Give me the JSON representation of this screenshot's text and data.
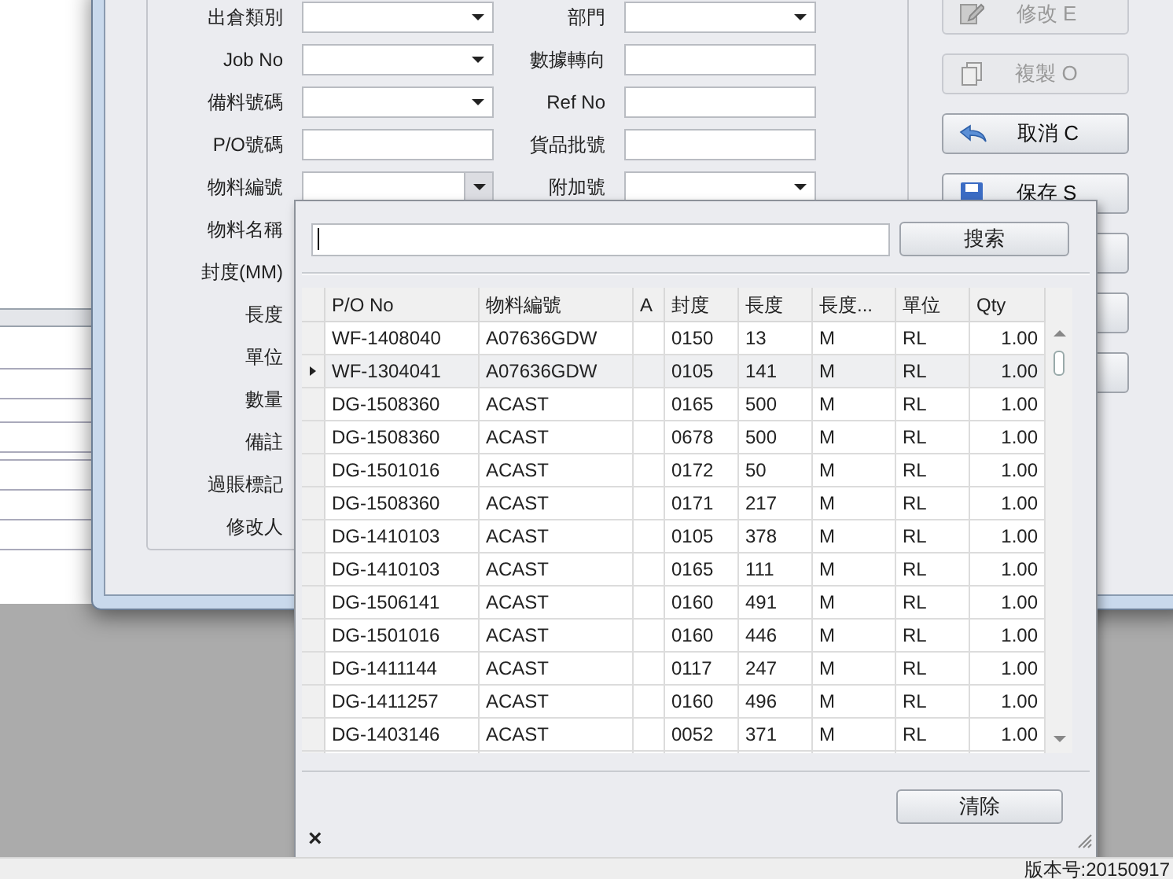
{
  "form": {
    "left_fields": [
      {
        "label": "出倉類別",
        "kind": "dropdown",
        "expanded": false
      },
      {
        "label": "Job No",
        "kind": "dropdown",
        "expanded": false
      },
      {
        "label": "備料號碼",
        "kind": "dropdown",
        "expanded": false
      },
      {
        "label": "P/O號碼",
        "kind": "text"
      },
      {
        "label": "物料編號",
        "kind": "dropdown",
        "expanded": true
      },
      {
        "label": "物料名稱",
        "kind": "hidden"
      },
      {
        "label": "封度(MM)",
        "kind": "hidden"
      },
      {
        "label": "長度",
        "kind": "hidden"
      },
      {
        "label": "單位",
        "kind": "hidden"
      },
      {
        "label": "數量",
        "kind": "hidden"
      },
      {
        "label": "備註",
        "kind": "hidden"
      },
      {
        "label": "過賬標記",
        "kind": "hidden"
      },
      {
        "label": "修改人",
        "kind": "hidden"
      }
    ],
    "right_fields": [
      {
        "label": "部門",
        "kind": "dropdown",
        "expanded": false
      },
      {
        "label": "數據轉向",
        "kind": "text"
      },
      {
        "label": "Ref No",
        "kind": "text"
      },
      {
        "label": "貨品批號",
        "kind": "text"
      },
      {
        "label": "附加號",
        "kind": "dropdown",
        "expanded": false
      }
    ]
  },
  "actions": [
    {
      "label": "修改 E",
      "kind": "edit",
      "disabled": true
    },
    {
      "label": "複製 O",
      "kind": "copy",
      "disabled": true
    },
    {
      "label": "取消 C",
      "kind": "undo",
      "disabled": false
    },
    {
      "label": "保存 S",
      "kind": "save",
      "disabled": false
    }
  ],
  "popup": {
    "search_button": "搜索",
    "columns": [
      "P/O No",
      "物料編號",
      "A",
      "封度",
      "長度",
      "長度...",
      "單位",
      "Qty"
    ],
    "rows": [
      {
        "selected": false,
        "cells": [
          "WF-1408040",
          "A07636GDW",
          "",
          "0150",
          "13",
          "M",
          "RL",
          "1.00"
        ]
      },
      {
        "selected": true,
        "cells": [
          "WF-1304041",
          "A07636GDW",
          "",
          "0105",
          "141",
          "M",
          "RL",
          "1.00"
        ]
      },
      {
        "selected": false,
        "cells": [
          "DG-1508360",
          "ACAST",
          "",
          "0165",
          "500",
          "M",
          "RL",
          "1.00"
        ]
      },
      {
        "selected": false,
        "cells": [
          "DG-1508360",
          "ACAST",
          "",
          "0678",
          "500",
          "M",
          "RL",
          "1.00"
        ]
      },
      {
        "selected": false,
        "cells": [
          "DG-1501016",
          "ACAST",
          "",
          "0172",
          "50",
          "M",
          "RL",
          "1.00"
        ]
      },
      {
        "selected": false,
        "cells": [
          "DG-1508360",
          "ACAST",
          "",
          "0171",
          "217",
          "M",
          "RL",
          "1.00"
        ]
      },
      {
        "selected": false,
        "cells": [
          "DG-1410103",
          "ACAST",
          "",
          "0105",
          "378",
          "M",
          "RL",
          "1.00"
        ]
      },
      {
        "selected": false,
        "cells": [
          "DG-1410103",
          "ACAST",
          "",
          "0165",
          "111",
          "M",
          "RL",
          "1.00"
        ]
      },
      {
        "selected": false,
        "cells": [
          "DG-1506141",
          "ACAST",
          "",
          "0160",
          "491",
          "M",
          "RL",
          "1.00"
        ]
      },
      {
        "selected": false,
        "cells": [
          "DG-1501016",
          "ACAST",
          "",
          "0160",
          "446",
          "M",
          "RL",
          "1.00"
        ]
      },
      {
        "selected": false,
        "cells": [
          "DG-1411144",
          "ACAST",
          "",
          "0117",
          "247",
          "M",
          "RL",
          "1.00"
        ]
      },
      {
        "selected": false,
        "cells": [
          "DG-1411257",
          "ACAST",
          "",
          "0160",
          "496",
          "M",
          "RL",
          "1.00"
        ]
      },
      {
        "selected": false,
        "cells": [
          "DG-1403146",
          "ACAST",
          "",
          "0052",
          "371",
          "M",
          "RL",
          "1.00"
        ]
      }
    ],
    "clear_button": "清除",
    "close": "×"
  },
  "status_bar": "版本号:20150917"
}
